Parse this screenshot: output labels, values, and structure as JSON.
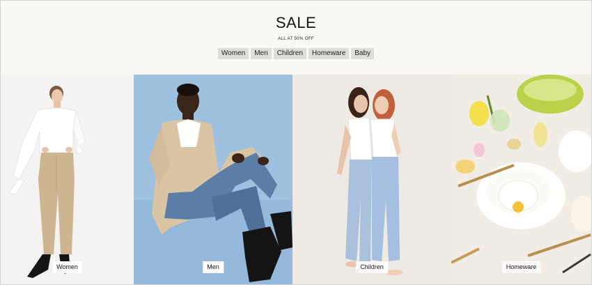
{
  "hero": {
    "title": "SALE",
    "subtitle": "ALL AT 50% OFF"
  },
  "categories": [
    "Women",
    "Men",
    "Children",
    "Homeware",
    "Baby"
  ],
  "tiles": [
    {
      "label": "Women",
      "image": "woman-in-white-shirt-and-beige-trousers"
    },
    {
      "label": "Men",
      "image": "man-in-beige-cardigan-and-jeans-seated"
    },
    {
      "label": "Children",
      "image": "two-girls-in-white-tees-and-jeans"
    },
    {
      "label": "Homeware",
      "image": "table-setting-with-flower-plates-and-glassware"
    }
  ],
  "colors": {
    "hero_background": "#f9f8f4",
    "tab_background": "#dddddb",
    "men_backdrop": "#9ec1e0"
  }
}
